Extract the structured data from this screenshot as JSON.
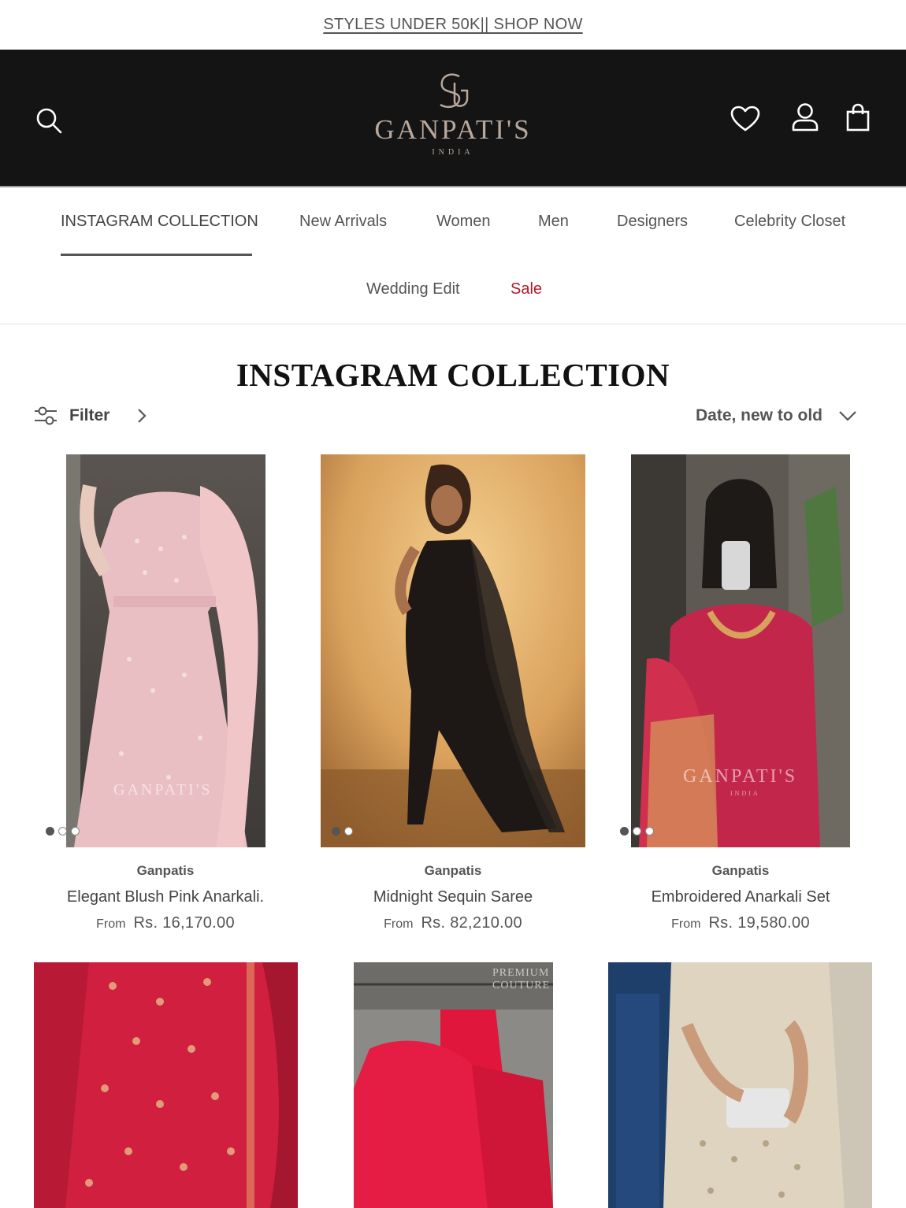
{
  "announcement": {
    "text": "STYLES UNDER 50K|| SHOP NOW"
  },
  "header": {
    "logo_word": "GANPATI'S",
    "logo_sub": "INDIA",
    "icons": [
      "search-icon",
      "heart-icon",
      "account-icon",
      "bag-icon"
    ]
  },
  "nav": {
    "items": [
      {
        "label": "INSTAGRAM COLLECTION"
      },
      {
        "label": "New Arrivals"
      },
      {
        "label": "Women"
      },
      {
        "label": "Men"
      },
      {
        "label": "Designers"
      },
      {
        "label": "Celebrity Closet"
      },
      {
        "label": "Wedding Edit"
      },
      {
        "label": "Sale"
      }
    ],
    "sale_color": "#b0192b"
  },
  "collection": {
    "title": "INSTAGRAM COLLECTION",
    "filter_label": "Filter",
    "sort_label": "Date, new to old"
  },
  "products": [
    {
      "vendor": "Ganpatis",
      "name": "Elegant Blush Pink Anarkali.",
      "from": "From",
      "price": "Rs. 16,170.00",
      "image_count": 3,
      "active_image": 1
    },
    {
      "vendor": "Ganpatis",
      "name": "Midnight Sequin Saree",
      "from": "From",
      "price": "Rs. 82,210.00",
      "image_count": 2,
      "active_image": 1
    },
    {
      "vendor": "Ganpatis",
      "name": "Embroidered Anarkali Set",
      "from": "From",
      "price": "Rs. 19,580.00",
      "image_count": 3,
      "active_image": 1
    }
  ],
  "watermarks": {
    "card1": "GANPATI'S",
    "card3": "GANPATI'S",
    "card3_sub": "INDIA",
    "card5": "PREMIUM COUTURE"
  }
}
